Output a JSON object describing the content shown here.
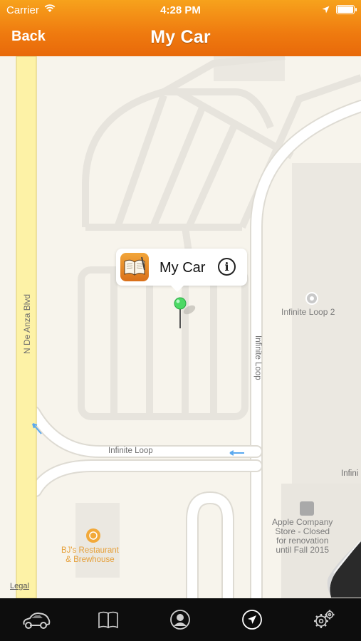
{
  "status_bar": {
    "carrier": "Carrier",
    "time": "4:28 PM"
  },
  "nav": {
    "back_label": "Back",
    "title": "My Car"
  },
  "map": {
    "street_labels": {
      "de_anza": "N De Anza Blvd",
      "infinite_loop_h": "Infinite Loop",
      "infinite_loop_v": "Infinite Loop",
      "infini_edge": "Infini"
    },
    "pois": {
      "infinite_loop_2": "Infinite Loop 2",
      "bjs_line1": "BJ's Restaurant",
      "bjs_line2": "& Brewhouse",
      "apple_line1": "Apple Company",
      "apple_line2": "Store - Closed",
      "apple_line3": "for renovation",
      "apple_line4": "until Fall 2015"
    },
    "legal": "Legal",
    "pin_color": "#4cd964"
  },
  "callout": {
    "title": "My Car",
    "icon": "book-icon",
    "info_icon": "info-icon"
  },
  "tabbar": {
    "items": [
      {
        "icon": "car-icon"
      },
      {
        "icon": "book-icon"
      },
      {
        "icon": "person-icon"
      },
      {
        "icon": "location-arrow-icon"
      },
      {
        "icon": "gear-icon"
      }
    ]
  },
  "colors": {
    "nav_orange": "#ef7a0f",
    "tabbar_bg": "#0d0d0d",
    "map_bg": "#f7f4ec"
  }
}
